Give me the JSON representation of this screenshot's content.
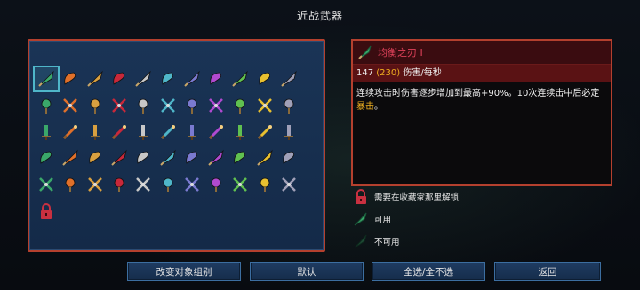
{
  "title": "近战武器",
  "grid": {
    "rows": [
      [
        "leaf-blade-icon",
        "flame-dagger-icon",
        "torch-sword-icon",
        "red-whip-icon",
        "twin-swords-icon",
        "ice-spear-icon",
        "shovel-icon",
        "spiked-mace-icon",
        "green-cleaver-icon",
        "golden-broadsword-icon",
        "crossed-swords-icon"
      ],
      [
        "serpent-blade-icon",
        "purple-rapier-icon",
        "blue-saber-icon",
        "spear-icon",
        "green-dagger-icon",
        "fire-whip-icon",
        "violet-claw-icon",
        "shock-gauntlet-icon",
        "red-boot-icon",
        "orange-axe-icon",
        "war-axe-icon"
      ],
      [
        "violet-horn-icon",
        "chain-whip-icon",
        "red-claws-icon",
        "purple-scythe-icon",
        "flame-fist-icon",
        "steel-pike-icon",
        "long-sword-icon",
        "twin-axes-icon",
        "hook-blade-icon",
        "magnifier-icon",
        "scroll-icon"
      ],
      [
        "purple-umbrella-icon",
        "cane-icon",
        "bronze-dagger-icon",
        "violet-sickle-icon",
        "lantern-icon",
        "blue-knife-icon",
        "tombstone-icon",
        "dark-shield-icon",
        "wooden-club-icon",
        "crossed-blades-icon",
        "frost-sword-icon"
      ],
      [
        "silver-lance-icon",
        "bone-club-icon",
        "trident-icon",
        "chain-hook-icon",
        "blue-hammer-icon",
        "crescent-sword-icon",
        "spiked-ball-icon",
        "golden-rapier-icon",
        "yellow-dagger-icon",
        "pickaxe-icon",
        "ring-blade-icon"
      ],
      [
        "locked-icon"
      ]
    ]
  },
  "detail": {
    "name": "均衡之刃 I",
    "stat_base": "147",
    "stat_alt": "(230)",
    "stat_unit": "伤害/每秒",
    "desc_pre": "连续攻击时伤害逐步增加到最高+90%。10次连续击中后必定",
    "desc_hl": "暴击",
    "desc_post": "。"
  },
  "legend": {
    "locked": "需要在收藏家那里解锁",
    "available": "可用",
    "unavailable": "不可用"
  },
  "buttons": {
    "change_group": "改变对象组别",
    "default": "默认",
    "select_all": "全选/全不选",
    "back": "返回"
  },
  "colors": {
    "accent_red": "#b4402e",
    "highlight_gold": "#f0b020",
    "name_red": "#e0425a",
    "selection_cyan": "#4fb6c9"
  }
}
